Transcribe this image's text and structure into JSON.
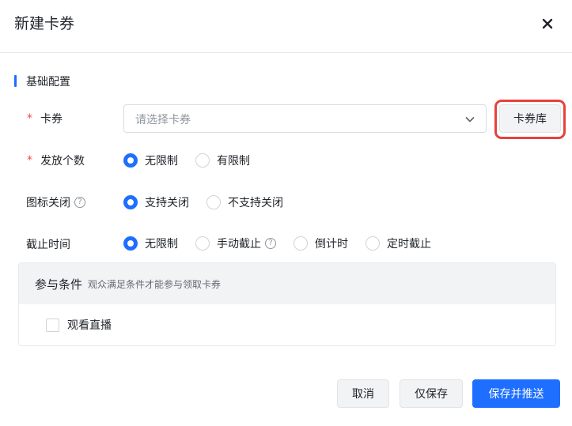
{
  "dialog": {
    "title": "新建卡券",
    "close_icon": "close-icon"
  },
  "section": {
    "title": "基础配置",
    "accent_color": "#1e6fff"
  },
  "fields": {
    "coupon": {
      "label": "卡券",
      "required": "*",
      "placeholder": "请选择卡券",
      "library_button": "卡券库"
    },
    "quantity": {
      "label": "发放个数",
      "required": "*",
      "options": [
        "无限制",
        "有限制"
      ],
      "selected": "无限制"
    },
    "icon_close": {
      "label": "图标关闭",
      "help": "?",
      "options": [
        "支持关闭",
        "不支持关闭"
      ],
      "selected": "支持关闭"
    },
    "deadline": {
      "label": "截止时间",
      "options": [
        "无限制",
        "手动截止",
        "倒计时",
        "定时截止"
      ],
      "help": "?",
      "selected": "无限制"
    }
  },
  "conditions": {
    "title": "参与条件",
    "subtitle": "观众满足条件才能参与领取卡券",
    "checkbox_label": "观看直播",
    "checked": false
  },
  "footer": {
    "cancel": "取消",
    "save": "仅保存",
    "save_push": "保存并推送"
  },
  "colors": {
    "primary": "#1e6fff",
    "required": "#f54a45",
    "highlight": "#e8413c"
  }
}
